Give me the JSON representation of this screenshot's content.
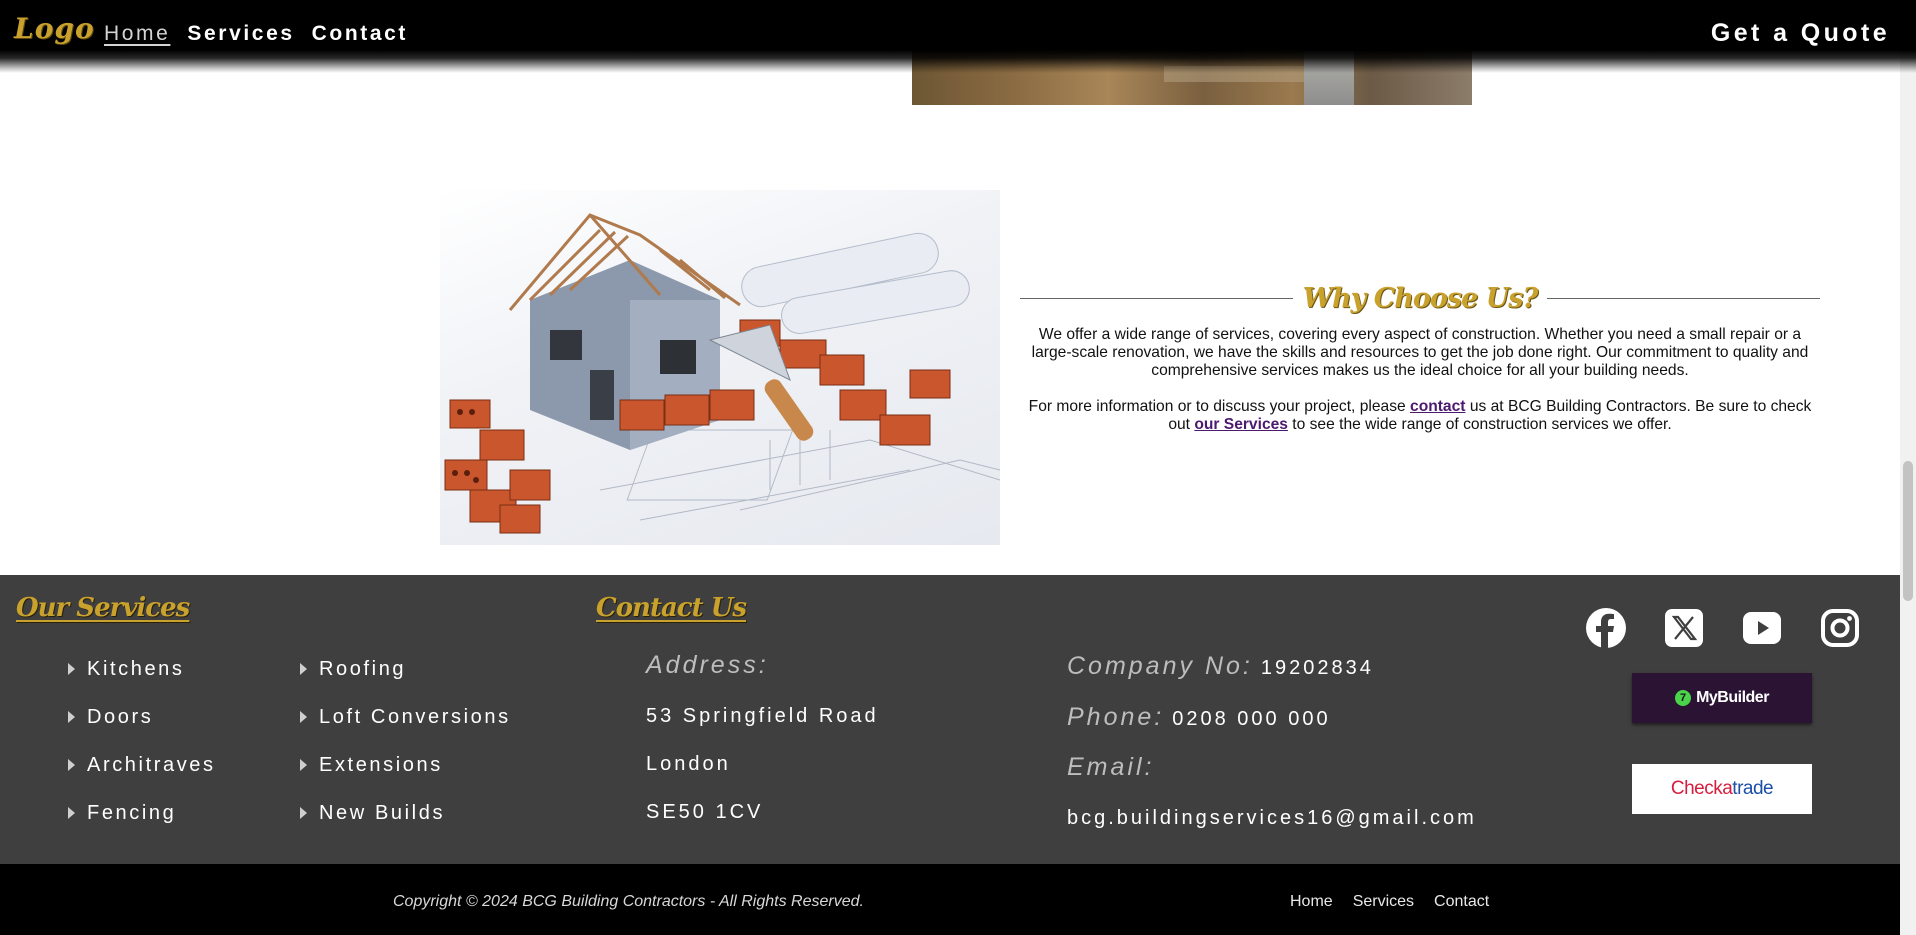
{
  "header": {
    "logo": "Logo",
    "nav": [
      "Home",
      "Services",
      "Contact"
    ],
    "quote_button": "Get a Quote"
  },
  "why_choose": {
    "heading": "Why Choose Us?",
    "paragraph1": "We offer a wide range of services, covering every aspect of construction. Whether you need a small repair or a large-scale renovation, we have the skills and resources to get the job done right. Our commitment to quality and comprehensive services makes us the ideal choice for all your building needs.",
    "paragraph2": {
      "before": "For more information or to discuss your project, please ",
      "contact_link": "contact",
      "middle": " us at BCG Building Contractors. Be sure to check out ",
      "services_link": "our Services",
      "after": " to see the wide range of construction services we offer."
    }
  },
  "footer": {
    "services_title": "Our Services",
    "services_col1": [
      "Kitchens",
      "Doors",
      "Architraves",
      "Fencing"
    ],
    "services_col2": [
      "Roofing",
      "Loft Conversions",
      "Extensions",
      "New Builds"
    ],
    "contact_title": "Contact Us",
    "address_label": "Address:",
    "address_lines": [
      "53 Springfield Road",
      "London",
      "SE50 1CV"
    ],
    "company_label": "Company No:",
    "company_value": "19202834",
    "phone_label": "Phone:",
    "phone_value": "0208 000 000",
    "email_label": "Email:",
    "email_value": "bcg.buildingservices16@gmail.com",
    "social_icons": [
      "facebook-icon",
      "x-icon",
      "youtube-icon",
      "instagram-icon"
    ],
    "mybuilder_label": "MyBuilder",
    "checkatrade_part1": "Checka",
    "checkatrade_part2": "trade"
  },
  "bottom": {
    "copyright": "Copyright © 2024 BCG Building Contractors - All Rights Reserved.",
    "links": [
      "Home",
      "Services",
      "Contact"
    ]
  },
  "colors": {
    "accent_gold": "#c9a22e",
    "footer_bg": "#3f3f3f",
    "link_purple": "#4b1a6f",
    "mybuilder_bg": "#2a1333",
    "checkatrade_red": "#d51d3e",
    "checkatrade_blue": "#1b4fa8"
  }
}
